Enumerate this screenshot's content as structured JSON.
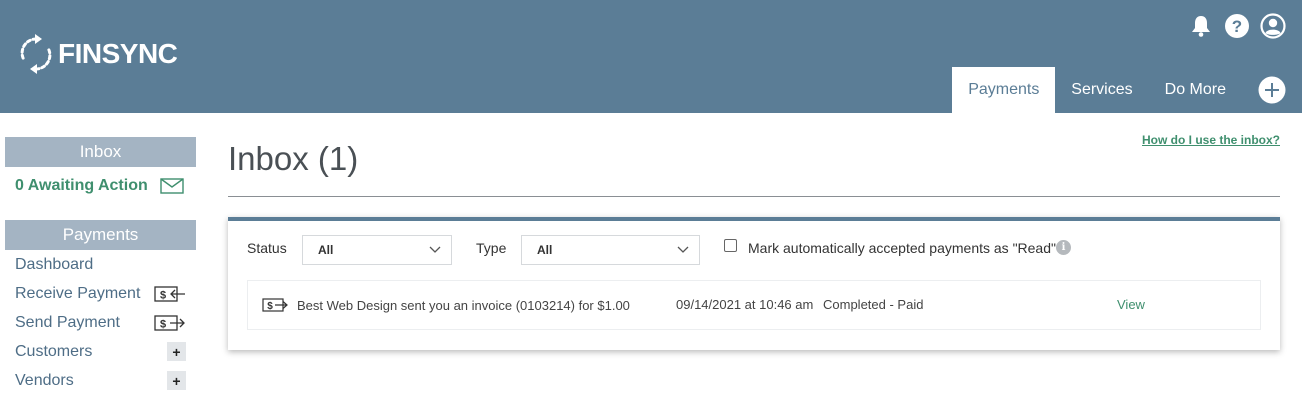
{
  "brand": {
    "name": "FINSYNC",
    "color": "#5b7d96",
    "accent": "#3f8f6e"
  },
  "top_icons": [
    "bell-icon",
    "help-icon",
    "user-icon"
  ],
  "nav": {
    "tabs": [
      {
        "label": "Payments",
        "active": true
      },
      {
        "label": "Services",
        "active": false
      },
      {
        "label": "Do More",
        "active": false
      }
    ],
    "plus_icon": "plus-circle-icon"
  },
  "sidebar": {
    "inbox_header": "Inbox",
    "awaiting_label": "0 Awaiting Action",
    "payments_header": "Payments",
    "items": [
      {
        "label": "Dashboard",
        "icon": ""
      },
      {
        "label": "Receive Payment",
        "icon": "receive-payment-icon"
      },
      {
        "label": "Send Payment",
        "icon": "send-payment-icon"
      },
      {
        "label": "Customers",
        "icon": "plus-icon"
      },
      {
        "label": "Vendors",
        "icon": "plus-icon"
      }
    ]
  },
  "main": {
    "help_link": "How do I use the inbox?",
    "title": "Inbox (1)",
    "filters": {
      "status_label": "Status",
      "status_value": "All",
      "type_label": "Type",
      "type_value": "All",
      "checkbox_label": "Mark automatically accepted payments as \"Read\"",
      "checkbox_checked": false
    },
    "rows": [
      {
        "description": "Best Web Design sent you an invoice (0103214) for $1.00",
        "date": "09/14/2021 at 10:46 am",
        "status": "Completed - Paid",
        "action": "View"
      }
    ]
  }
}
